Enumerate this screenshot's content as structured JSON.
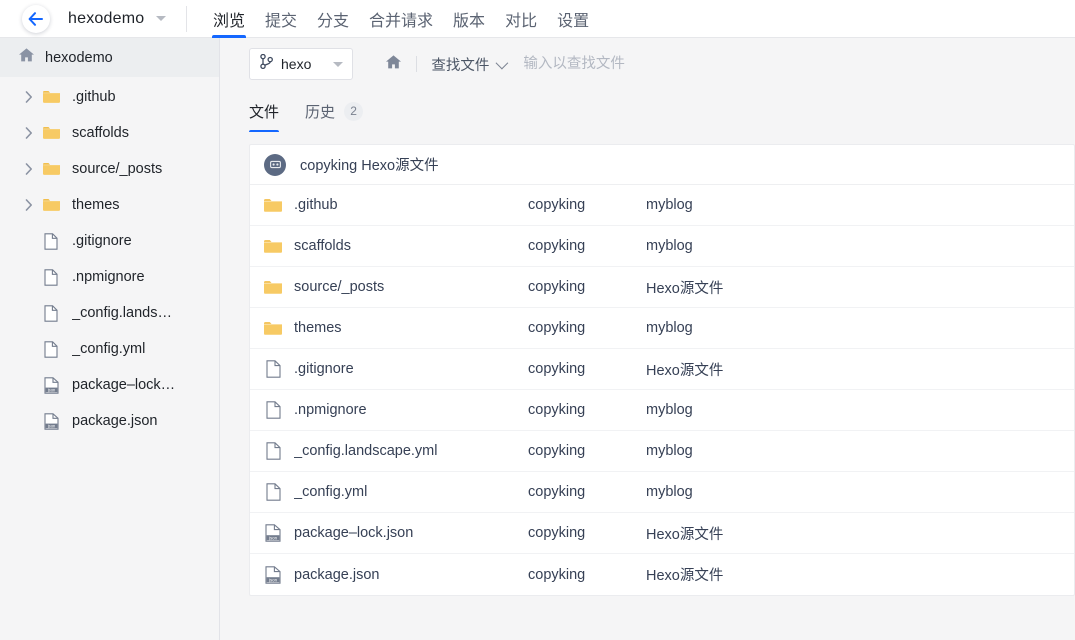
{
  "colors": {
    "accent": "#1467ff",
    "folder": "#f7ca64",
    "avatar_bg": "#5c6a83",
    "page_bg": "#f5f5f6",
    "panel_bg": "#ffffff",
    "text": "#1f2329",
    "text_muted": "#5b6372",
    "placeholder": "#b3b8c2"
  },
  "topbar": {
    "back_icon": "arrow-left-icon",
    "repo_name": "hexodemo",
    "repo_caret_icon": "caret-down-icon",
    "nav": [
      {
        "label": "浏览",
        "active": true
      },
      {
        "label": "提交",
        "active": false
      },
      {
        "label": "分支",
        "active": false
      },
      {
        "label": "合并请求",
        "active": false
      },
      {
        "label": "版本",
        "active": false
      },
      {
        "label": "对比",
        "active": false
      },
      {
        "label": "设置",
        "active": false
      }
    ]
  },
  "sidebar": {
    "header": {
      "icon": "home-icon",
      "label": "hexodemo"
    },
    "items": [
      {
        "label": ".github",
        "type": "folder",
        "expandable": true
      },
      {
        "label": "scaffolds",
        "type": "folder",
        "expandable": true
      },
      {
        "label": "source/_posts",
        "type": "folder",
        "expandable": true
      },
      {
        "label": "themes",
        "type": "folder",
        "expandable": true
      },
      {
        "label": ".gitignore",
        "type": "file",
        "expandable": false
      },
      {
        "label": ".npmignore",
        "type": "file",
        "expandable": false
      },
      {
        "label": "_config.lands…",
        "type": "file",
        "expandable": false
      },
      {
        "label": "_config.yml",
        "type": "file",
        "expandable": false
      },
      {
        "label": "package–lock…",
        "type": "json",
        "expandable": false
      },
      {
        "label": "package.json",
        "type": "json",
        "expandable": false
      }
    ]
  },
  "toolbar": {
    "branch_icon": "git-branch-icon",
    "branch_name": "hexo",
    "branch_caret_icon": "caret-down-icon",
    "home_icon": "home-icon",
    "finder_label": "查找文件",
    "finder_caret_icon": "chevron-down-icon",
    "finder_placeholder": "输入以查找文件",
    "finder_value": ""
  },
  "subtabs": [
    {
      "label": "文件",
      "active": true,
      "badge": ""
    },
    {
      "label": "历史",
      "active": false,
      "badge": "2"
    }
  ],
  "commit_bar": {
    "avatar_icon": "user-avatar-icon",
    "author": "copyking",
    "message": "Hexo源文件",
    "full_text": "copyking Hexo源文件"
  },
  "file_table": {
    "rows": [
      {
        "name": ".github",
        "type": "folder",
        "author": "copyking",
        "message": "myblog"
      },
      {
        "name": "scaffolds",
        "type": "folder",
        "author": "copyking",
        "message": "myblog"
      },
      {
        "name": "source/_posts",
        "type": "folder",
        "author": "copyking",
        "message": "Hexo源文件"
      },
      {
        "name": "themes",
        "type": "folder",
        "author": "copyking",
        "message": "myblog"
      },
      {
        "name": ".gitignore",
        "type": "file",
        "author": "copyking",
        "message": "Hexo源文件"
      },
      {
        "name": ".npmignore",
        "type": "file",
        "author": "copyking",
        "message": "myblog"
      },
      {
        "name": "_config.landscape.yml",
        "type": "file",
        "author": "copyking",
        "message": "myblog"
      },
      {
        "name": "_config.yml",
        "type": "file",
        "author": "copyking",
        "message": "myblog"
      },
      {
        "name": "package–lock.json",
        "type": "json",
        "author": "copyking",
        "message": "Hexo源文件"
      },
      {
        "name": "package.json",
        "type": "json",
        "author": "copyking",
        "message": "Hexo源文件"
      }
    ]
  }
}
